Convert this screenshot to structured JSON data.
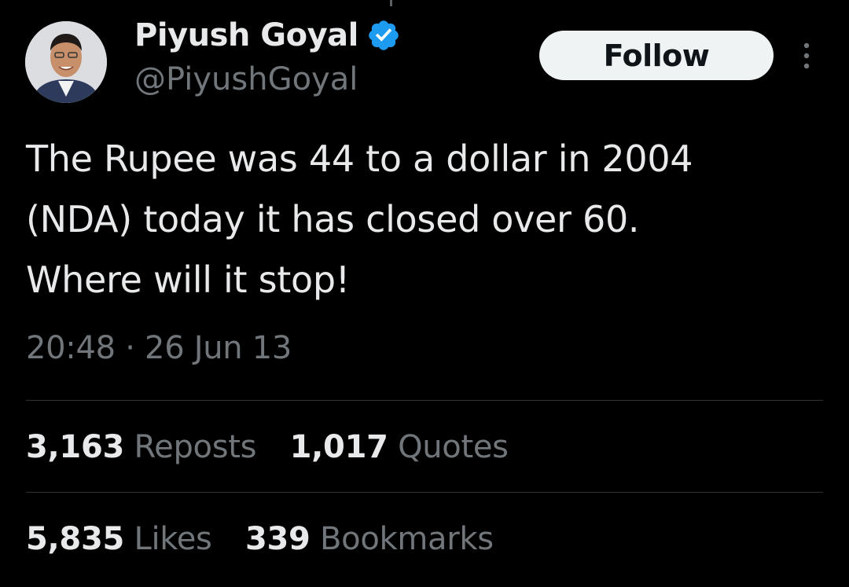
{
  "author": {
    "display_name": "Piyush Goyal",
    "handle": "@PiyushGoyal",
    "verified": true,
    "verified_color": "#1d9bf0"
  },
  "actions": {
    "follow_label": "Follow"
  },
  "tweet": {
    "text_lines": [
      "The Rupee was 44 to a dollar in 2004",
      "(NDA) today it has closed over 60.",
      "Where will it stop!"
    ],
    "time": "20:48",
    "separator": "·",
    "date": "26 Jun 13"
  },
  "stats": {
    "reposts_count": "3,163",
    "reposts_label": "Reposts",
    "quotes_count": "1,017",
    "quotes_label": "Quotes",
    "likes_count": "5,835",
    "likes_label": "Likes",
    "bookmarks_count": "339",
    "bookmarks_label": "Bookmarks"
  },
  "colors": {
    "background": "#000000",
    "primary_text": "#e7e9ea",
    "secondary_text": "#71767b",
    "divider": "#2f3336",
    "follow_bg": "#eff3f4"
  },
  "icons": {
    "verified": "verified-badge-icon",
    "more": "more-vertical-icon"
  }
}
